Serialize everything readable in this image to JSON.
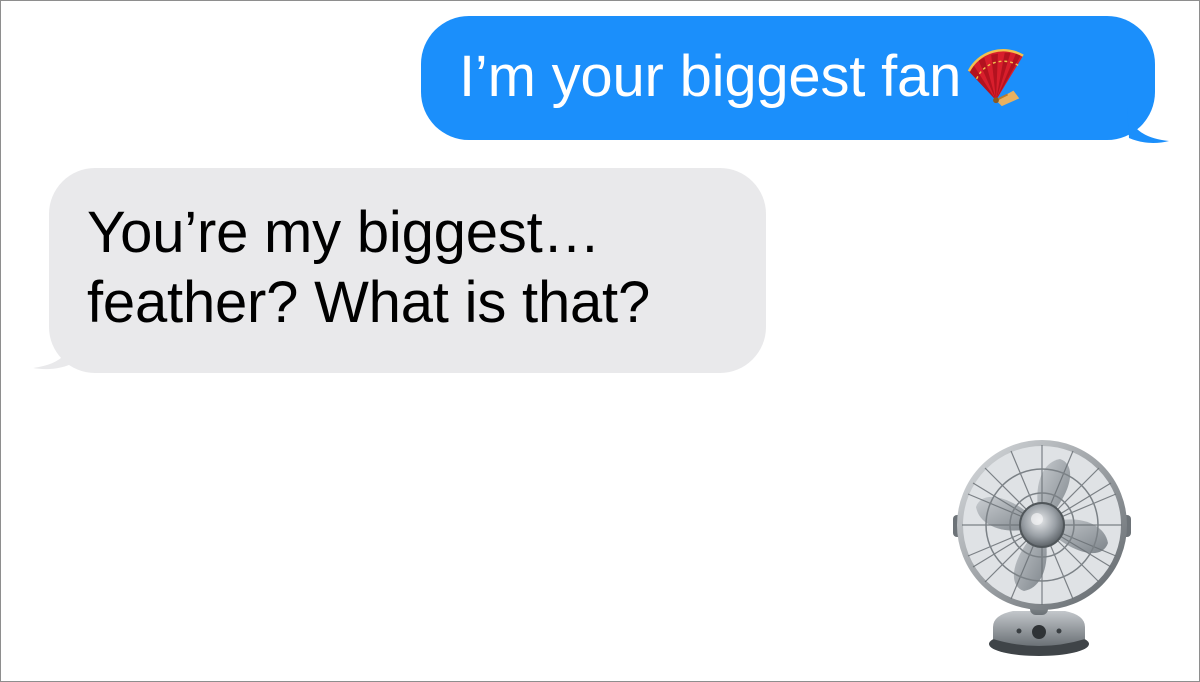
{
  "conversation": {
    "messages": [
      {
        "direction": "sent",
        "text": "I’m your biggest fan",
        "emoji": "folding-hand-fan",
        "color": "#1b8ffb"
      },
      {
        "direction": "received",
        "lines": [
          "You’re my biggest…",
          "feather? What is that?"
        ],
        "color": "#e9e9eb"
      }
    ]
  },
  "colors": {
    "sent_bubble": "#1b8ffb",
    "received_bubble": "#e9e9eb",
    "background": "#ffffff"
  },
  "icons": {
    "sent_emoji": "folding-hand-fan-icon",
    "illustration": "desk-fan-icon"
  }
}
